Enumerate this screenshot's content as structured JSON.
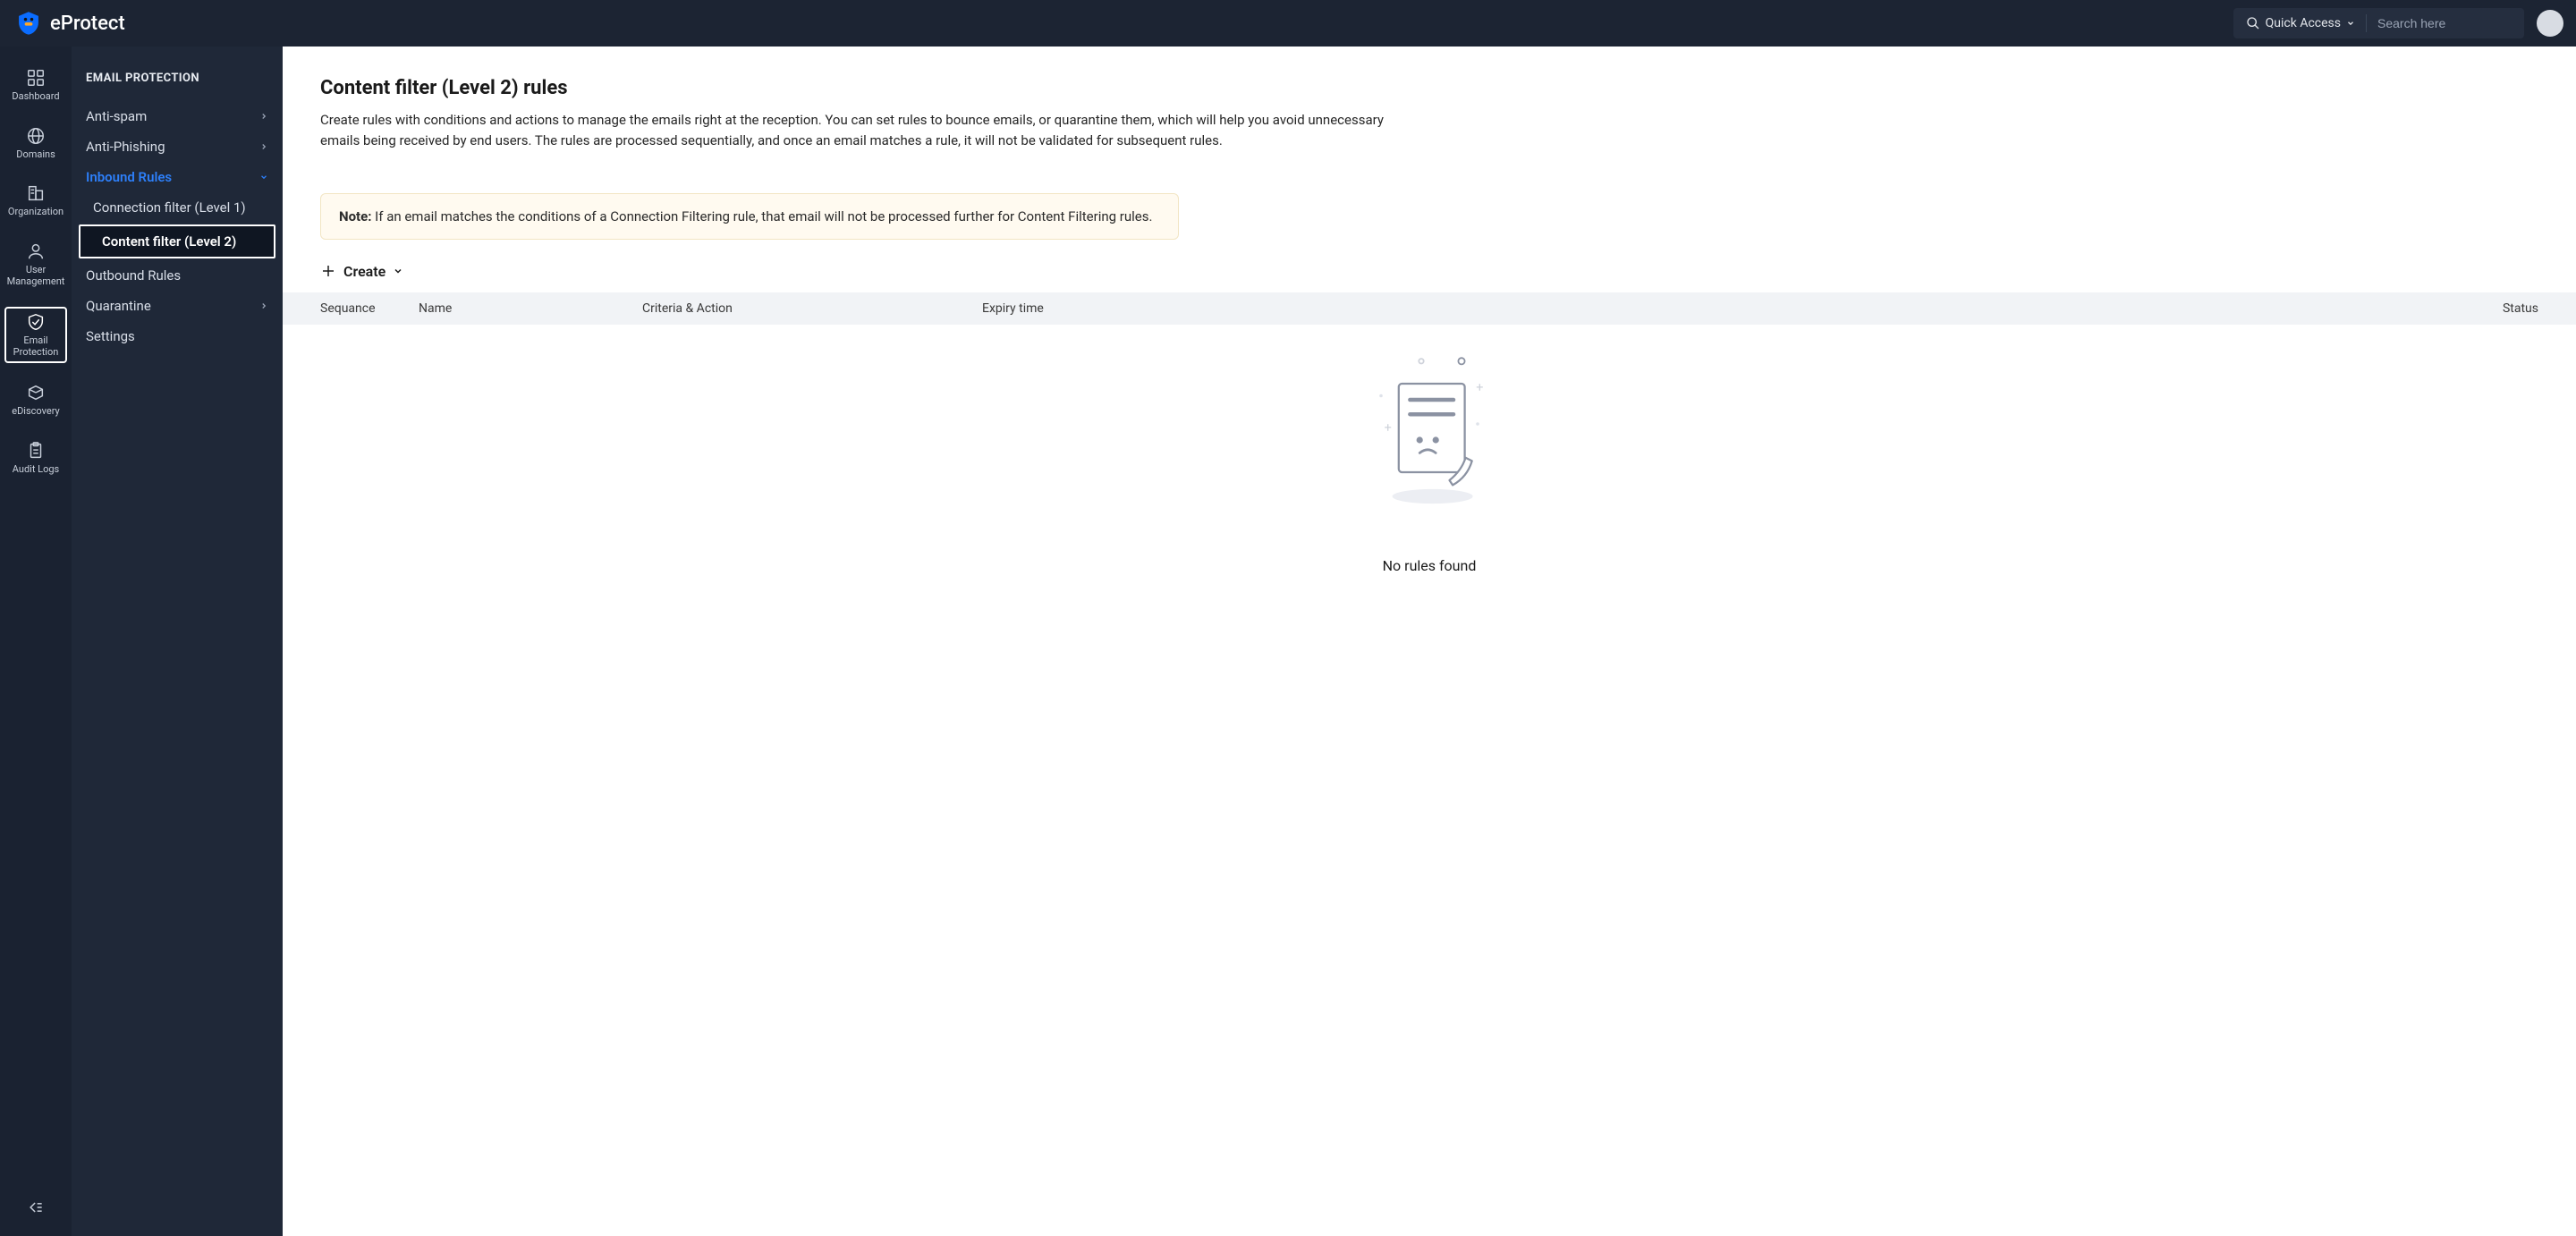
{
  "brand": {
    "name": "eProtect"
  },
  "topbar": {
    "quick_access_label": "Quick Access",
    "search_placeholder": "Search here"
  },
  "rail": {
    "items": [
      {
        "key": "dashboard",
        "label": "Dashboard",
        "icon": "grid"
      },
      {
        "key": "domains",
        "label": "Domains",
        "icon": "globe"
      },
      {
        "key": "organization",
        "label": "Organization",
        "icon": "building"
      },
      {
        "key": "user-mgmt",
        "label": "User Management",
        "icon": "user"
      },
      {
        "key": "email-protection",
        "label": "Email Protection",
        "icon": "shield",
        "selected": true
      },
      {
        "key": "ediscovery",
        "label": "eDiscovery",
        "icon": "box"
      },
      {
        "key": "audit-logs",
        "label": "Audit Logs",
        "icon": "clipboard"
      }
    ]
  },
  "nav": {
    "section_title": "EMAIL PROTECTION",
    "items": [
      {
        "key": "anti-spam",
        "label": "Anti-spam",
        "expandable": true
      },
      {
        "key": "anti-phishing",
        "label": "Anti-Phishing",
        "expandable": true
      },
      {
        "key": "inbound",
        "label": "Inbound Rules",
        "expandable": true,
        "active": true,
        "children": [
          {
            "key": "conn-filter",
            "label": "Connection filter (Level 1)"
          },
          {
            "key": "content-filter",
            "label": "Content filter (Level 2)",
            "selected": true
          }
        ]
      },
      {
        "key": "outbound",
        "label": "Outbound Rules"
      },
      {
        "key": "quarantine",
        "label": "Quarantine",
        "expandable": true
      },
      {
        "key": "settings",
        "label": "Settings"
      }
    ]
  },
  "page": {
    "title": "Content filter (Level 2) rules",
    "description": "Create rules with conditions and actions to manage the emails right at the reception. You can set rules to bounce emails, or quarantine them, which will help you avoid unnecessary emails being received by end users. The rules are processed sequentially, and once an email matches a rule, it will not be validated for subsequent rules.",
    "note_label": "Note:",
    "note_text": " If an email matches the conditions of a Connection Filtering rule, that email will not be processed further for Content Filtering rules.",
    "create_label": "Create",
    "columns": {
      "sequence": "Sequance",
      "name": "Name",
      "criteria": "Criteria & Action",
      "expiry": "Expiry time",
      "status": "Status"
    },
    "empty_text": "No rules found"
  }
}
